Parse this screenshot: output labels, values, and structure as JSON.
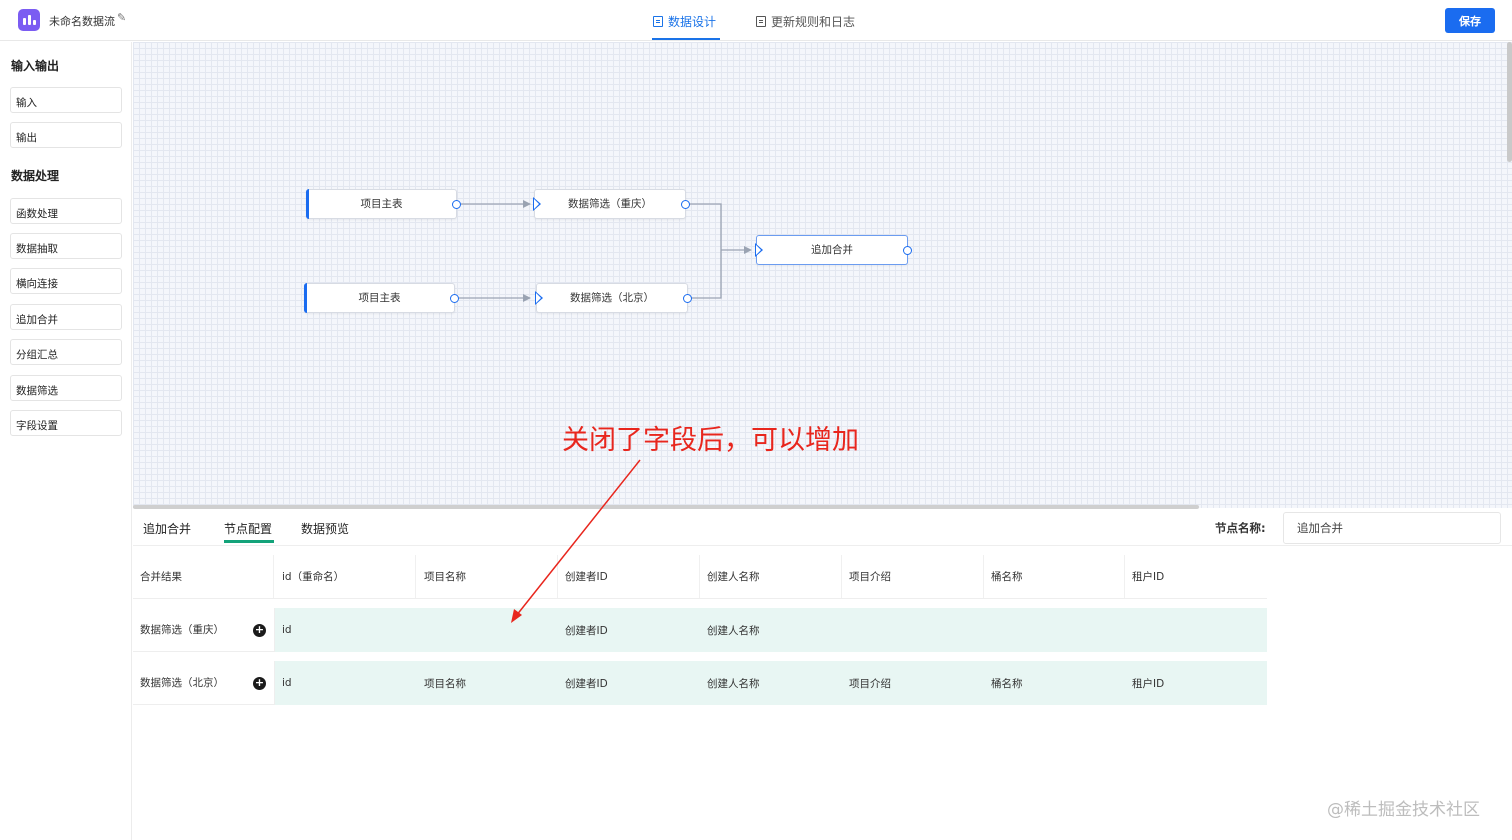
{
  "header": {
    "app_title": "未命名数据流",
    "tabs": [
      {
        "label": "数据设计",
        "active": true
      },
      {
        "label": "更新规则和日志",
        "active": false
      }
    ],
    "save_label": "保存",
    "accent_color": "#1a6cf0"
  },
  "sidebar": {
    "sections": [
      {
        "title": "输入输出",
        "items": [
          "输入",
          "输出"
        ]
      },
      {
        "title": "数据处理",
        "items": [
          "函数处理",
          "数据抽取",
          "横向连接",
          "追加合并",
          "分组汇总",
          "数据筛选",
          "字段设置"
        ]
      }
    ]
  },
  "canvas": {
    "nodes": [
      {
        "label": "项目主表"
      },
      {
        "label": "数据筛选（重庆）"
      },
      {
        "label": "项目主表"
      },
      {
        "label": "数据筛选（北京）"
      },
      {
        "label": "追加合并"
      }
    ]
  },
  "panel": {
    "tabs": [
      "追加合并",
      "节点配置",
      "数据预览"
    ],
    "active_tab": "节点配置",
    "node_name_label": "节点名称:",
    "node_name_value": "追加合并",
    "table": {
      "headers": [
        "合并结果",
        "id（重命名）",
        "项目名称",
        "创建者ID",
        "创建人名称",
        "项目介绍",
        "桶名称",
        "租户ID"
      ],
      "rows": [
        {
          "source": "数据筛选（重庆）",
          "cells": [
            "id",
            "",
            "创建者ID",
            "创建人名称",
            "",
            "",
            ""
          ]
        },
        {
          "source": "数据筛选（北京）",
          "cells": [
            "id",
            "项目名称",
            "创建者ID",
            "创建人名称",
            "项目介绍",
            "桶名称",
            "租户ID"
          ]
        }
      ]
    }
  },
  "annotation": {
    "text": "关闭了字段后，可以增加",
    "color": "#e8261d"
  },
  "watermark": "@稀土掘金技术社区"
}
